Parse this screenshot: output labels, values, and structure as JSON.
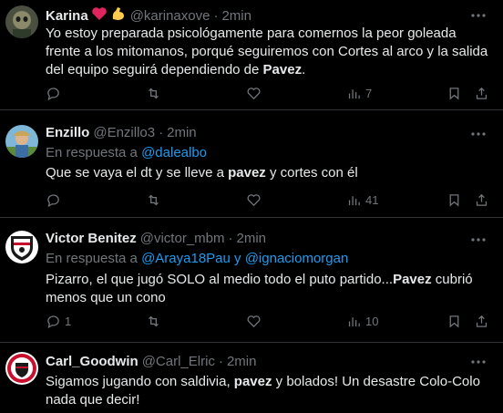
{
  "tweets": [
    {
      "name": "Karina",
      "handle": "@karinaxove",
      "time": "2min",
      "text_pre": "Yo estoy preparada psicológamente para comernos la peor goleada frente a los mitomanos, porqué seguiremos con Cortes al arco y la salida del equipo seguirá dependiendo de ",
      "text_bold": "Pavez",
      "text_post": ".",
      "views": "7",
      "replies": "",
      "emojis": [
        "red-heart",
        "flexed-biceps"
      ]
    },
    {
      "name": "Enzillo",
      "handle": "@Enzillo3",
      "time": "2min",
      "reply_prefix": "En respuesta a ",
      "reply_mention": "@dalealbo",
      "text_pre": "Que se vaya el dt y se lleve a ",
      "text_bold": "pavez",
      "text_post": " y cortes con él",
      "views": "41",
      "replies": ""
    },
    {
      "name": "Victor Benitez",
      "handle": "@victor_mbm",
      "time": "2min",
      "reply_prefix": "En respuesta a ",
      "reply_mention": "@Araya18Pau y @ignaciomorgan",
      "text_pre": "Pizarro, el que jugó SOLO al medio todo el puto partido...",
      "text_bold": "Pavez",
      "text_post": " cubrió menos que un cono",
      "views": "10",
      "replies": "1"
    },
    {
      "name": "Carl_Goodwin",
      "handle": "@Carl_Elric",
      "time": "2min",
      "text_pre": "Sigamos jugando con saldivia, ",
      "text_bold": "pavez",
      "text_post": " y bolados! Un desastre Colo-Colo nada que decir!"
    }
  ],
  "separator": "·",
  "colors": {
    "background": "#000000",
    "text": "#e7e9ea",
    "muted": "#71767b",
    "link": "#1d9bf0",
    "border": "#2f3336"
  }
}
